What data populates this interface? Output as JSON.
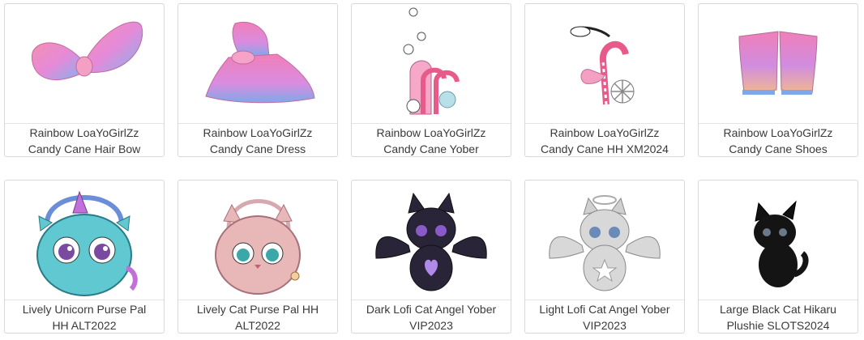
{
  "items": [
    {
      "line1": "Rainbow LoaYoGirlZz",
      "line2": "Candy Cane Hair Bow",
      "icon": "rainbow-hair-bow-icon"
    },
    {
      "line1": "Rainbow LoaYoGirlZz",
      "line2": "Candy Cane Dress",
      "icon": "rainbow-dress-icon"
    },
    {
      "line1": "Rainbow LoaYoGirlZz",
      "line2": "Candy Cane Yober",
      "icon": "candy-cane-yober-icon"
    },
    {
      "line1": "Rainbow LoaYoGirlZz",
      "line2": "Candy Cane HH XM2024",
      "icon": "candy-cane-hand-held-icon"
    },
    {
      "line1": "Rainbow LoaYoGirlZz",
      "line2": "Candy Cane Shoes",
      "icon": "rainbow-shoes-icon"
    },
    {
      "line1": "Lively Unicorn Purse Pal",
      "line2": "HH ALT2022",
      "icon": "unicorn-purse-icon"
    },
    {
      "line1": "Lively Cat Purse Pal HH",
      "line2": "ALT2022",
      "icon": "cat-purse-icon"
    },
    {
      "line1": "Dark Lofi Cat Angel Yober",
      "line2": "VIP2023",
      "icon": "dark-cat-angel-icon"
    },
    {
      "line1": "Light Lofi Cat Angel Yober",
      "line2": "VIP2023",
      "icon": "light-cat-angel-icon"
    },
    {
      "line1": "Large Black Cat Hikaru",
      "line2": "Plushie SLOTS2024",
      "icon": "black-cat-plushie-icon"
    }
  ],
  "colors": {
    "pink": "#f07fb0",
    "blue": "#7fa8e8",
    "purple": "#b07fd8",
    "teal": "#5fc8c8"
  }
}
